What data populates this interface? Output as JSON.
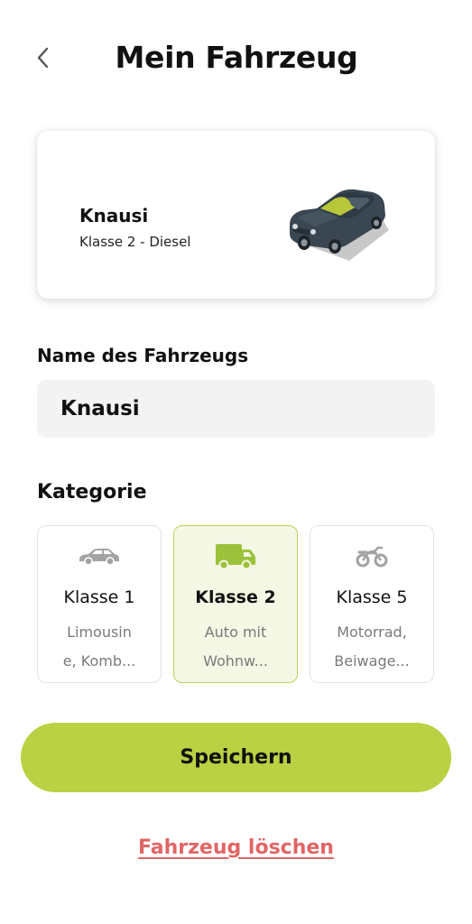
{
  "header": {
    "title": "Mein Fahrzeug",
    "back_icon": "chevron-left-icon"
  },
  "vehicle_card": {
    "name": "Knausi",
    "subtitle": "Klasse 2 - Diesel",
    "illustration": "car-illustration",
    "car_color": "#3a4752"
  },
  "name_field": {
    "label": "Name des Fahrzeugs",
    "value": "Knausi"
  },
  "category": {
    "label": "Kategorie",
    "selected": "Klasse 2",
    "options": [
      {
        "title": "Klasse 1",
        "description": "Limousin\ne, Komb...",
        "icon": "car-icon"
      },
      {
        "title": "Klasse 2",
        "description": "Auto mit\nWohnw...",
        "icon": "van-icon"
      },
      {
        "title": "Klasse 5",
        "description": "Motorrad,\nBeiwage...",
        "icon": "motorcycle-icon"
      }
    ]
  },
  "actions": {
    "save_label": "Speichern",
    "delete_label": "Fahrzeug löschen"
  },
  "colors": {
    "accent": "#b9d142",
    "selected_bg": "#f3f7e4",
    "selected_border": "#b9d35a",
    "danger": "#e06565",
    "input_bg": "#f3f3f3"
  }
}
